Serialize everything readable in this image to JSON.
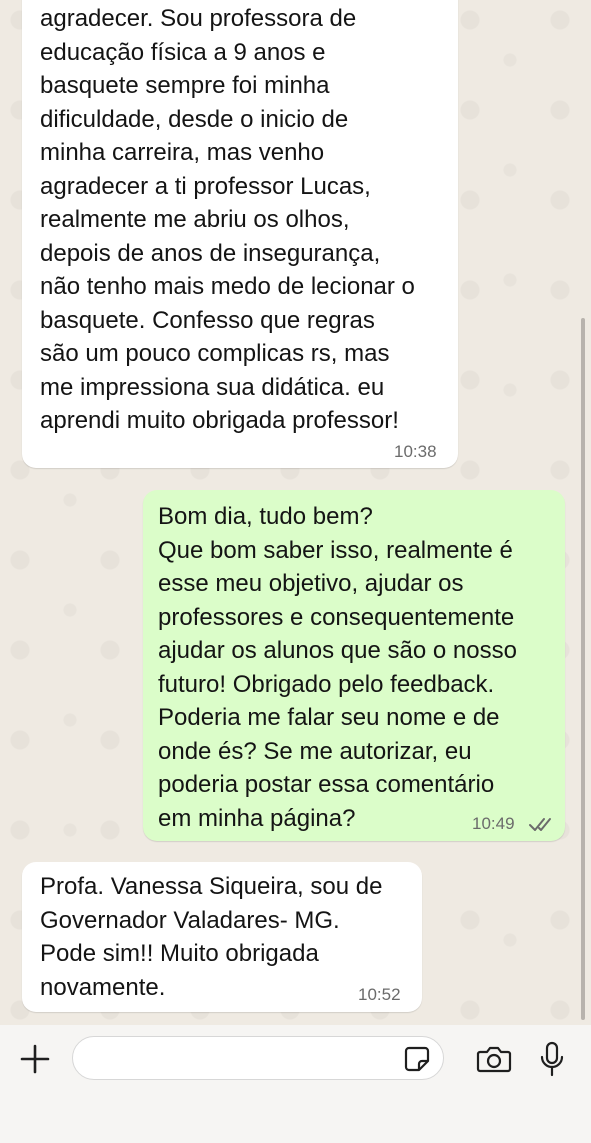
{
  "messages": [
    {
      "direction": "incoming",
      "text": "agradecer. Sou professora de\neducação física a 9 anos e\nbasquete sempre foi minha\ndificuldade, desde o inicio de\nminha carreira, mas venho\nagradecer a ti professor Lucas,\nrealmente me abriu os olhos,\ndepois de anos de insegurança,\nnão tenho mais medo de lecionar o\nbasquete. Confesso que regras\nsão um pouco complicas rs, mas\nme impressiona sua didática. eu\naprendi muito  obrigada professor!",
      "time": "10:38"
    },
    {
      "direction": "outgoing",
      "text": "Bom dia, tudo bem?\nQue bom saber isso, realmente é\nesse meu objetivo, ajudar os\nprofessores e consequentemente\najudar os alunos que são o nosso\nfuturo! Obrigado pelo feedback.\nPoderia me falar seu nome e de\nonde és? Se me autorizar, eu\npoderia postar essa comentário\nem minha página?",
      "time": "10:49",
      "status": "read",
      "status_icon": "double-check-icon"
    },
    {
      "direction": "incoming",
      "text": "Profa. Vanessa Siqueira, sou de\nGovernador Valadares- MG.\nPode sim!! Muito obrigada\nnovamente.",
      "time": "10:52"
    }
  ],
  "input_bar": {
    "placeholder": "",
    "icons": {
      "attach": "plus-icon",
      "sticker": "sticker-icon",
      "camera": "camera-icon",
      "mic": "microphone-icon"
    }
  },
  "colors": {
    "wallpaper": "#efeae2",
    "incoming_bubble": "#ffffff",
    "outgoing_bubble": "#dbfdc9",
    "read_ticks": "#6b6b6b"
  }
}
